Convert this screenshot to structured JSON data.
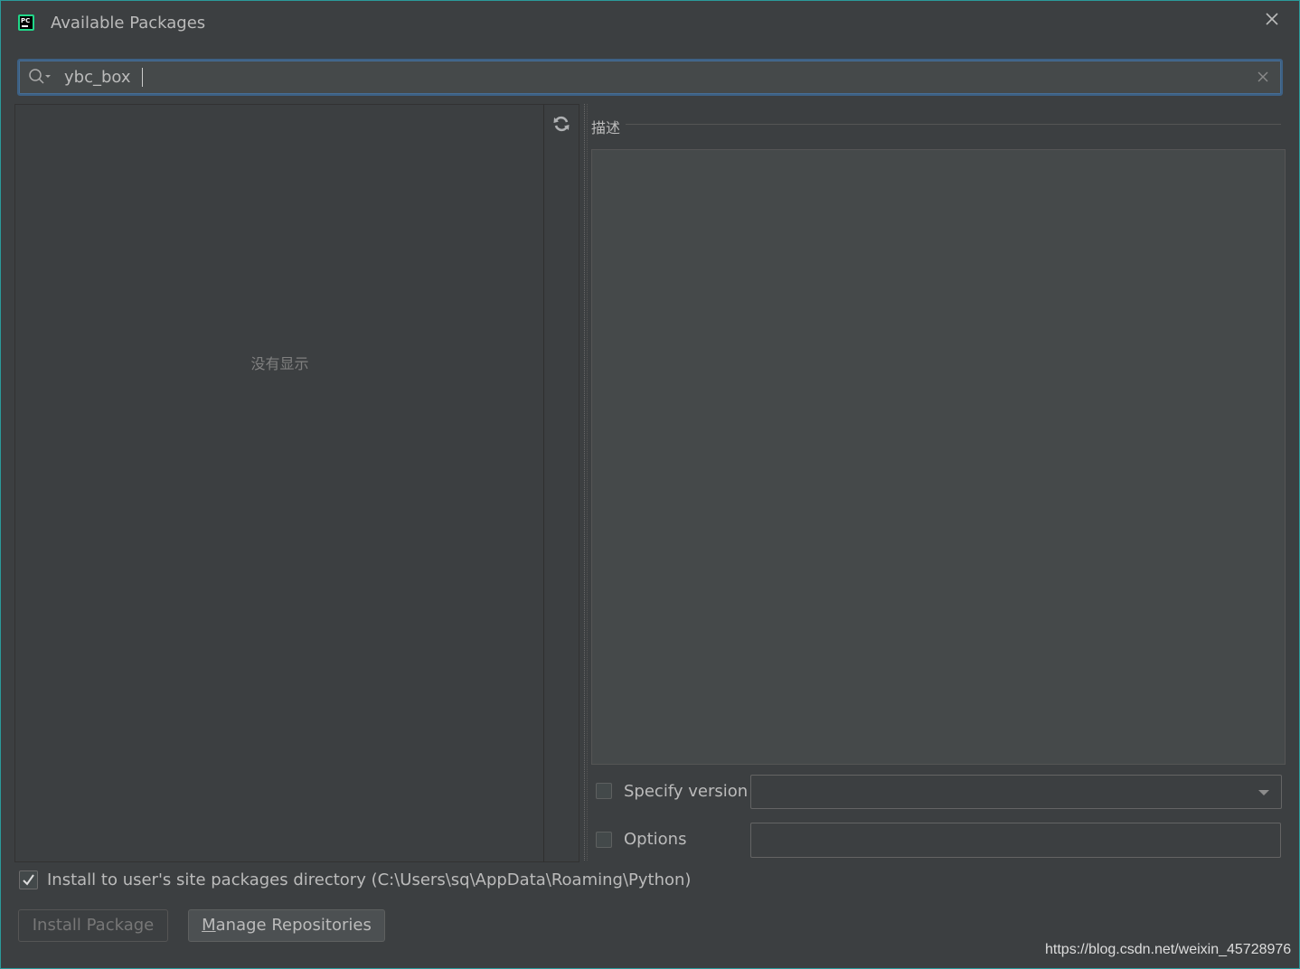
{
  "window": {
    "title": "Available Packages",
    "app_icon_text": "PC"
  },
  "search": {
    "value": "ybc_box",
    "placeholder": ""
  },
  "package_list": {
    "empty_text": "没有显示"
  },
  "description": {
    "label": "描述"
  },
  "specify_version": {
    "label": "Specify version",
    "checked": false,
    "selected": ""
  },
  "options": {
    "label": "Options",
    "checked": false,
    "value": ""
  },
  "install_user": {
    "label": "Install to user's site packages directory (C:\\Users\\sq\\AppData\\Roaming\\Python)",
    "checked": true
  },
  "buttons": {
    "install_label": "Install Package",
    "manage_prefix": "M",
    "manage_rest": "anage Repositories"
  },
  "watermark": "https://blog.csdn.net/weixin_45728976",
  "colors": {
    "background": "#3c3f41",
    "focus_border": "#3d6185",
    "text": "#bbbbbb"
  }
}
